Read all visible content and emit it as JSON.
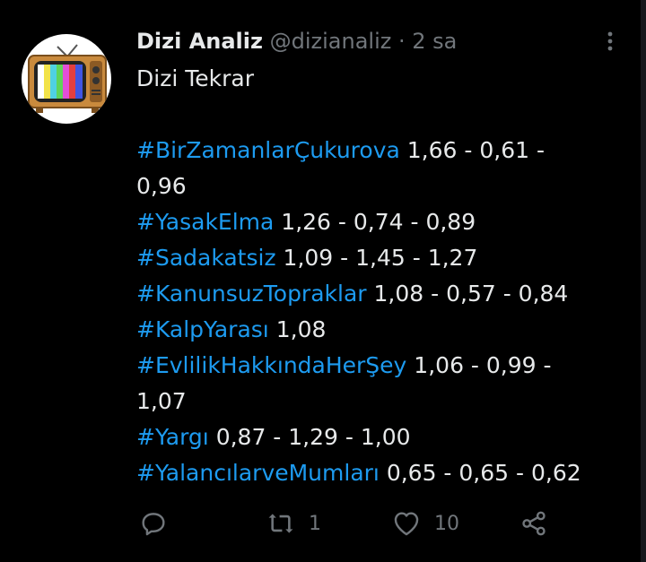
{
  "tweet": {
    "display_name": "Dizi Analiz",
    "handle": "@dizianaliz",
    "separator": "·",
    "time": "2 sa",
    "lines": [
      {
        "plain": "Dizi Tekrar"
      },
      {
        "plain": ""
      },
      {
        "tag": "#BirZamanlarÇukurova",
        "rest": " 1,66 - 0,61 -"
      },
      {
        "plain": "0,96"
      },
      {
        "tag": "#YasakElma",
        "rest": " 1,26 - 0,74 - 0,89"
      },
      {
        "tag": "#Sadakatsiz",
        "rest": " 1,09 - 1,45 - 1,27"
      },
      {
        "tag": "#KanunsuzTopraklar",
        "rest": " 1,08 - 0,57 - 0,84"
      },
      {
        "tag": "#KalpYarası",
        "rest": " 1,08"
      },
      {
        "tag": "#EvlilikHakkındaHerŞey",
        "rest": " 1,06 - 0,99 -"
      },
      {
        "plain": "1,07"
      },
      {
        "tag": "#Yargı",
        "rest": " 0,87 - 1,29 - 1,00"
      },
      {
        "tag": "#YalancılarveMumları",
        "rest": " 0,65 - 0,65 - 0,62"
      }
    ],
    "actions": {
      "reply_count": "",
      "retweet_count": "1",
      "like_count": "10"
    }
  },
  "colors": {
    "background": "#000000",
    "hashtag": "#1d9bf0",
    "muted": "#71767b",
    "text": "#e7e9ea"
  }
}
